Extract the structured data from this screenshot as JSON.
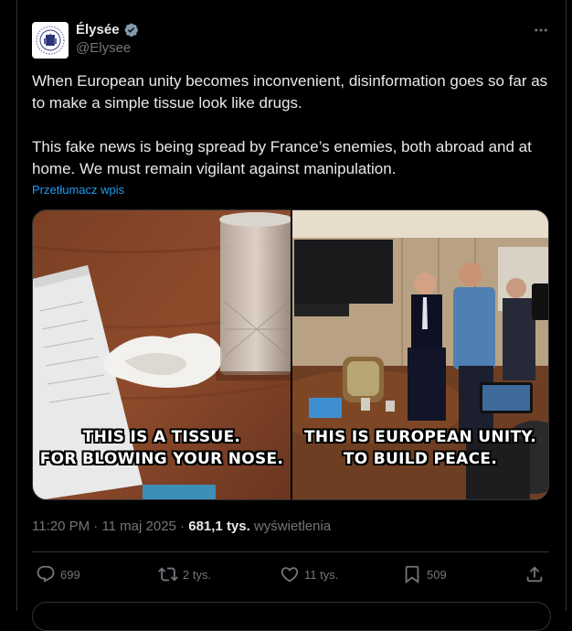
{
  "author": {
    "display_name": "Élysée",
    "handle": "@Elysee",
    "verified": true,
    "verified_badge_color": "#829aab"
  },
  "tweet": {
    "paragraphs": [
      "When European unity becomes inconvenient, disinformation goes so far as to make a simple tissue look like drugs.",
      "This fake news is being spread by France’s enemies, both abroad and at home. We must remain vigilant against manipulation."
    ],
    "translate_label": "Przetłumacz wpis"
  },
  "media": {
    "left_caption": [
      "THIS IS A TISSUE.",
      "FOR BLOWING YOUR NOSE."
    ],
    "right_caption": [
      "THIS IS EUROPEAN UNITY.",
      "TO BUILD PEACE."
    ]
  },
  "meta": {
    "time": "11:20 PM",
    "separator": "·",
    "date": "11 maj 2025",
    "views_count": "681,1 tys.",
    "views_label": "wyświetlenia"
  },
  "actions": {
    "replies": "699",
    "reposts": "2 tys.",
    "likes": "11 tys.",
    "bookmarks": "509"
  },
  "icons": [
    "more-icon",
    "verified-icon",
    "reply-icon",
    "repost-icon",
    "like-icon",
    "bookmark-icon",
    "share-icon"
  ],
  "colors": {
    "background": "#000000",
    "text": "#e7e9ea",
    "secondary_text": "#71767b",
    "link": "#1d9bf0",
    "border": "#2f3336"
  }
}
